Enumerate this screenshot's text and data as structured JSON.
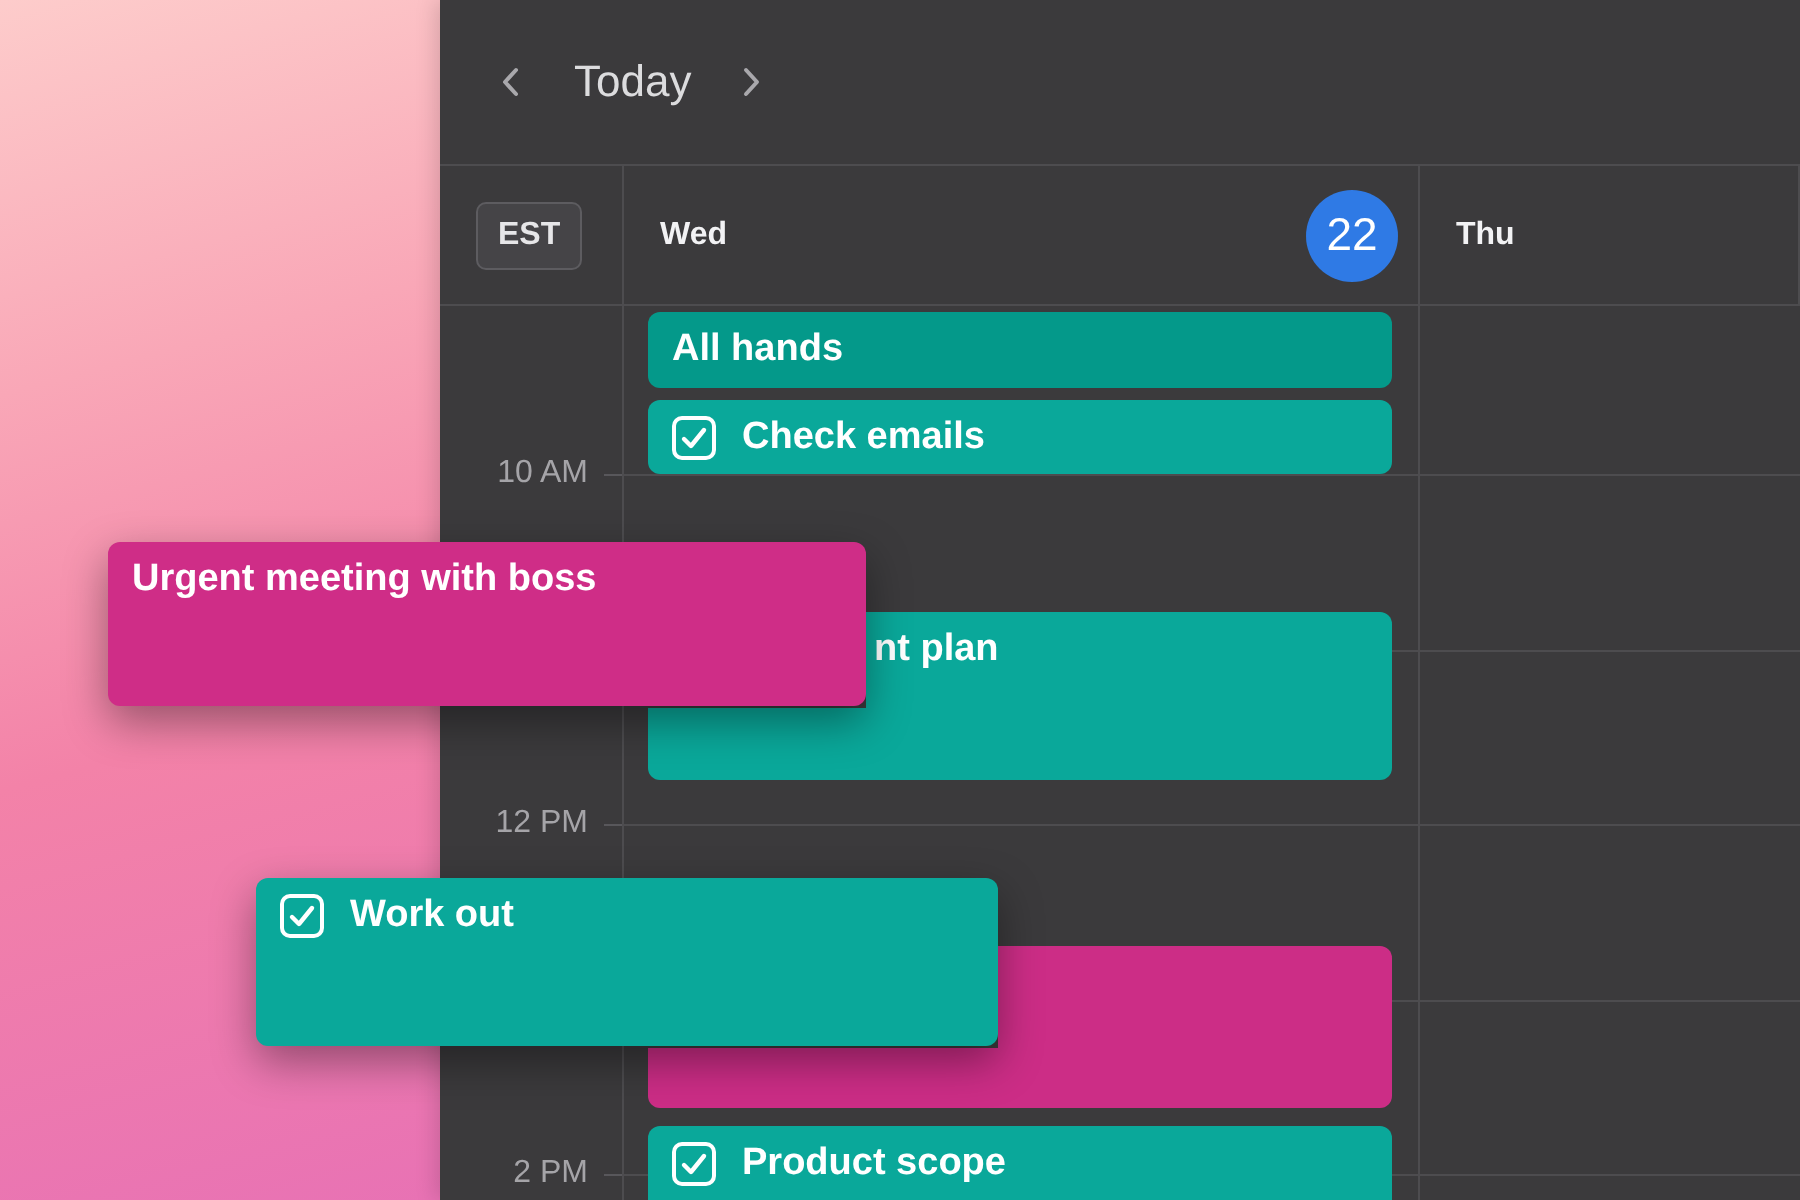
{
  "header": {
    "title": "Today"
  },
  "timezone": "EST",
  "days": [
    {
      "name": "Wed",
      "date": "22",
      "today": true
    },
    {
      "name": "Thu"
    }
  ],
  "time_labels": [
    "10 AM",
    "12 PM",
    "2 PM"
  ],
  "events": [
    {
      "title": "All hands",
      "kind": "event",
      "color": "#04998a"
    },
    {
      "title": "Check emails",
      "kind": "task",
      "checked": true,
      "color": "#0aa89a"
    },
    {
      "title": "nt plan",
      "kind": "event",
      "color": "#0aa89a"
    },
    {
      "kind": "event",
      "color": "#cc2d86"
    },
    {
      "title": "Product scope",
      "kind": "task",
      "checked": true,
      "color": "#0aa89a"
    }
  ],
  "floating_cards": [
    {
      "title": "Urgent meeting with boss",
      "kind": "event",
      "color": "#cf2d87"
    },
    {
      "title": "Work out",
      "kind": "task",
      "checked": true,
      "color": "#0aa89a"
    }
  ]
}
